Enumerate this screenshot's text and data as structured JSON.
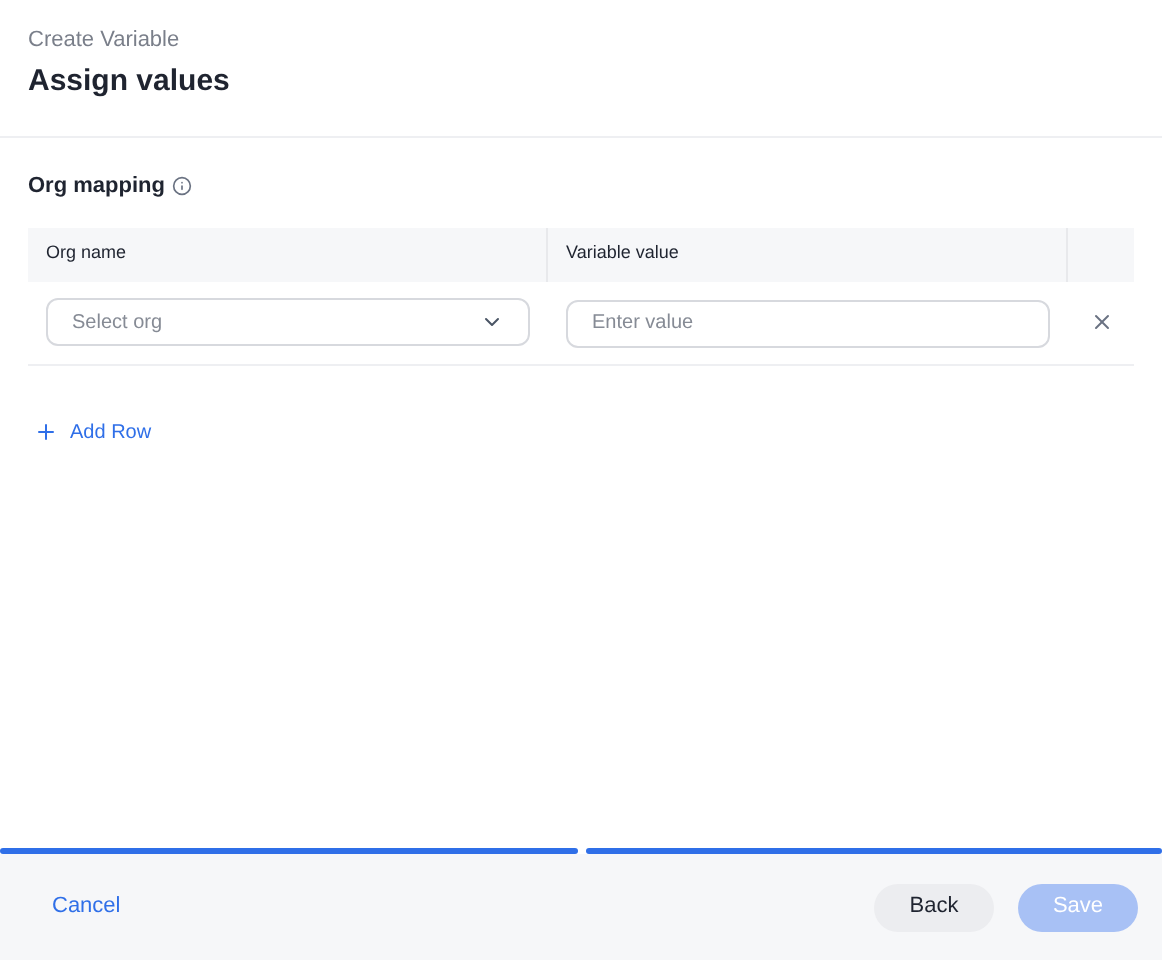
{
  "header": {
    "subtitle": "Create Variable",
    "title": "Assign values"
  },
  "section": {
    "label": "Org mapping"
  },
  "table": {
    "columns": [
      "Org name",
      "Variable value"
    ],
    "rows": [
      {
        "org": {
          "placeholder": "Select org"
        },
        "value": {
          "placeholder": "Enter value"
        }
      }
    ]
  },
  "add_row": "Add Row",
  "progress": [
    {
      "done": true
    },
    {
      "done": true
    }
  ],
  "footer": {
    "cancel": "Cancel",
    "back": {
      "label": "Back",
      "disabled": false
    },
    "save": {
      "label": "Save",
      "disabled": true
    }
  }
}
